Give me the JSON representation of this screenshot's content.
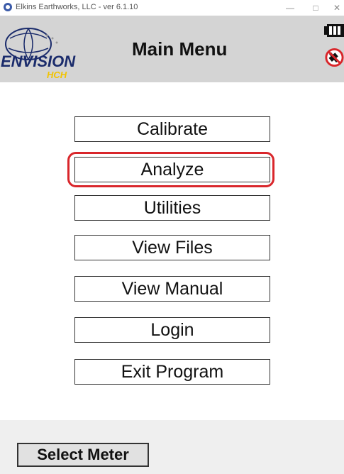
{
  "titlebar": {
    "title": "Elkins Earthworks, LLC - ver 6.1.10",
    "minimize": "—",
    "maximize": "□",
    "close": "✕"
  },
  "header": {
    "title": "Main Menu",
    "logo_text": "ENVISION",
    "logo_subtext": "HCH"
  },
  "menu": {
    "items": [
      "Calibrate",
      "Analyze",
      "Utilities",
      "View Files",
      "View Manual",
      "Login",
      "Exit Program"
    ]
  },
  "footer": {
    "select_meter_label": "Select Meter"
  },
  "colors": {
    "header_bg": "#d4d4d4",
    "highlight": "#d9262b",
    "logo_blue": "#1a2b6b",
    "logo_yellow": "#f2c400"
  },
  "icons": [
    "app-icon",
    "battery-icon",
    "no-signal-icon"
  ]
}
